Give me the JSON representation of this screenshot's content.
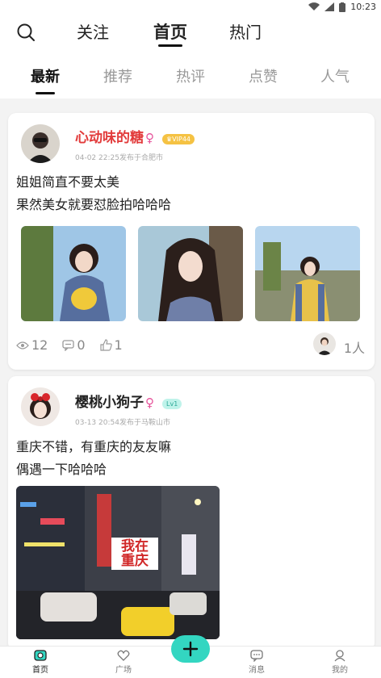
{
  "status_bar": {
    "time": "10:23"
  },
  "top_nav": {
    "tabs": [
      {
        "label": "关注"
      },
      {
        "label": "首页"
      },
      {
        "label": "热门"
      }
    ]
  },
  "sub_tabs": [
    {
      "label": "最新"
    },
    {
      "label": "推荐"
    },
    {
      "label": "热评"
    },
    {
      "label": "点赞"
    },
    {
      "label": "人气"
    }
  ],
  "posts": [
    {
      "username": "心动味的糖",
      "gender_symbol": "♀",
      "badge": "VIP44",
      "meta": "04-02 22:25发布于合肥市",
      "lines": [
        "姐姐简直不要太美",
        "果然美女就要怼脸拍哈哈哈"
      ],
      "views": "12",
      "comments": "0",
      "likes": "1",
      "readers": "1人"
    },
    {
      "username": "樱桃小狗子",
      "gender_symbol": "♀",
      "badge": "Lv1",
      "meta": "03-13 20:54发布于马鞍山市",
      "lines": [
        "重庆不错，有重庆的友友嘛",
        "偶遇一下哈哈哈"
      ],
      "photo_sign": [
        "我在",
        "重庆"
      ]
    }
  ],
  "bottom_nav": [
    {
      "label": "首页",
      "icon": "camera-icon"
    },
    {
      "label": "广场",
      "icon": "heart-icon"
    },
    {
      "label": "消息",
      "icon": "chat-icon"
    },
    {
      "label": "我的",
      "icon": "user-icon"
    }
  ],
  "colors": {
    "accent": "#33d6c1",
    "username_red": "#e23b3b",
    "vip_badge": "#f5c243",
    "lv_badge": "#bff3ea"
  }
}
